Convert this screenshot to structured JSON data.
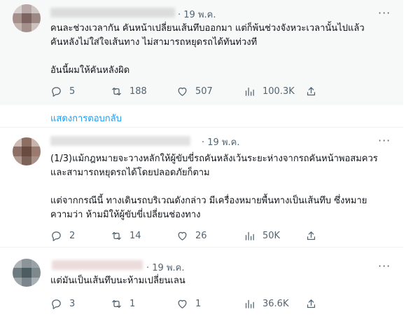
{
  "tweets": [
    {
      "date": "· 19 พ.ค.",
      "text": "คนละช่วงเวลากัน คันหน้าเปลี่ยนเส้นทึบออกมา แต่ก็พ้นช่วงจังหวะเวลานั้นไปแล้ว\nคันหลังไม่ใส่ใจเส้นทาง ไม่สามารถหยุดรถได้ทันท่วงที\n\nอันนี้ผมให้คันหลังผิด",
      "replies": "5",
      "retweets": "188",
      "likes": "507",
      "views": "100.3K"
    },
    {
      "date": "· 19 พ.ค.",
      "text": "(1/3)แม้กฎหมายจะวางหลักให้ผู้ขับขี่รถคันหลังเว้นระยะห่างจากรถคันหน้าพอสมควร\nและสามารถหยุดรถได้โดยปลอดภัยก็ตาม\n\nแต่จากกรณีนี้ ทางเดินรถบริเวณดังกล่าว มีเครื่องหมายพื้นทางเป็นเส้นทึบ ซึ่งหมาย\nความว่า ห้ามมิให้ผู้ขับขี่เปลี่ยนช่องทาง",
      "replies": "2",
      "retweets": "14",
      "likes": "26",
      "views": "50K"
    },
    {
      "date": "· 19 พ.ค.",
      "text": "แต่มันเป็นเส้นทึบนะห้ามเปลี่ยนเลน",
      "replies": "3",
      "retweets": "1",
      "likes": "1",
      "views": "36.6K"
    }
  ],
  "show_replies_label": "แสดงการตอบกลับ",
  "more_label": "···",
  "colors": {
    "text": "#0f1419",
    "muted": "#536471",
    "link": "#1d9bf0",
    "highlight_bg": "#f7f9f9"
  },
  "icons": [
    "reply-icon",
    "retweet-icon",
    "like-icon",
    "views-icon",
    "share-icon",
    "more-icon"
  ]
}
